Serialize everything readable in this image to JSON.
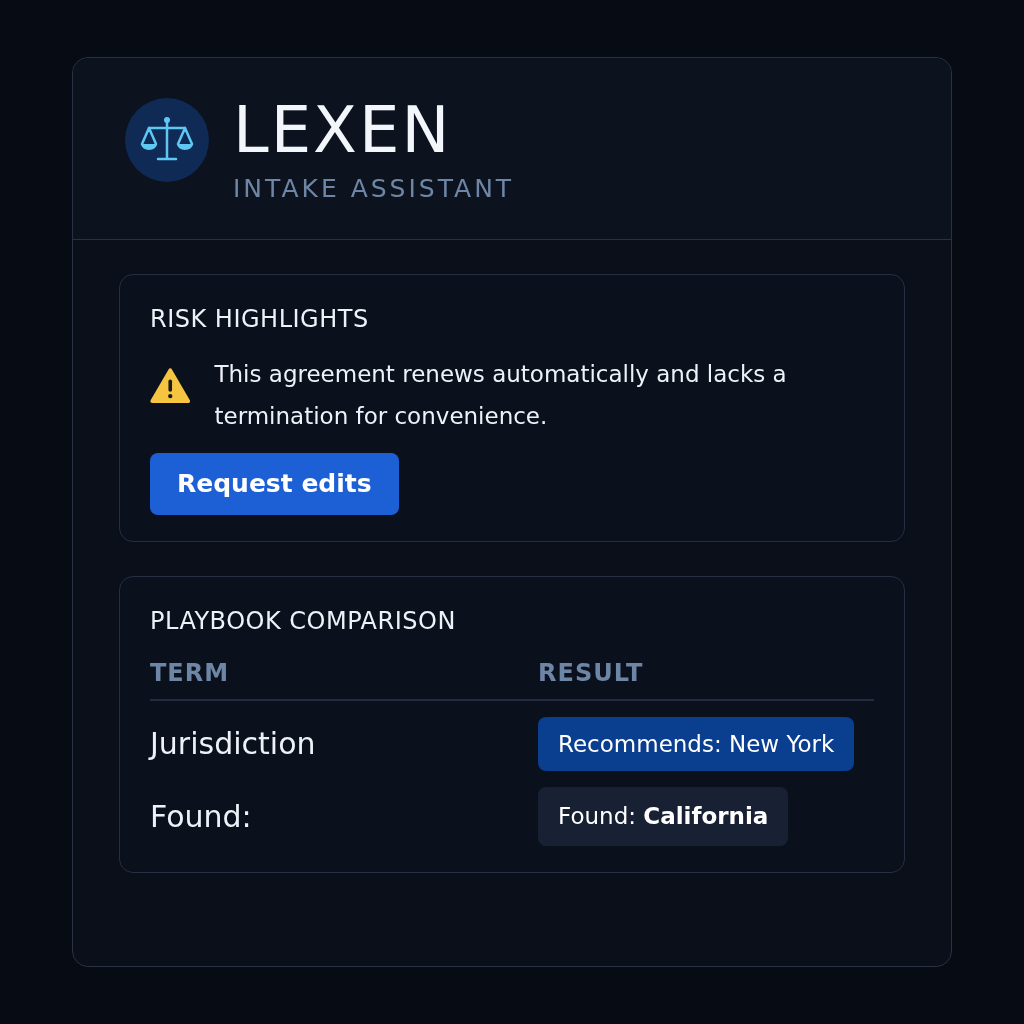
{
  "app": {
    "name": "LEXEN",
    "subtitle": "INTAKE ASSISTANT"
  },
  "risk_highlights": {
    "title": "RISK HIGHLIGHTS",
    "message": "This agreement renews automatically and lacks a termination for convenience.",
    "button": "Request edits"
  },
  "playbook_comparison": {
    "title": "PLAYBOOK COMPARISON",
    "columns": [
      "TERM",
      "RESULT"
    ],
    "rows": [
      {
        "term": "Jurisdiction",
        "result": "Recommends: New York",
        "kind": "recommendation"
      },
      {
        "term": "Found:",
        "result": "Found: **California**",
        "kind": "found"
      }
    ]
  }
}
